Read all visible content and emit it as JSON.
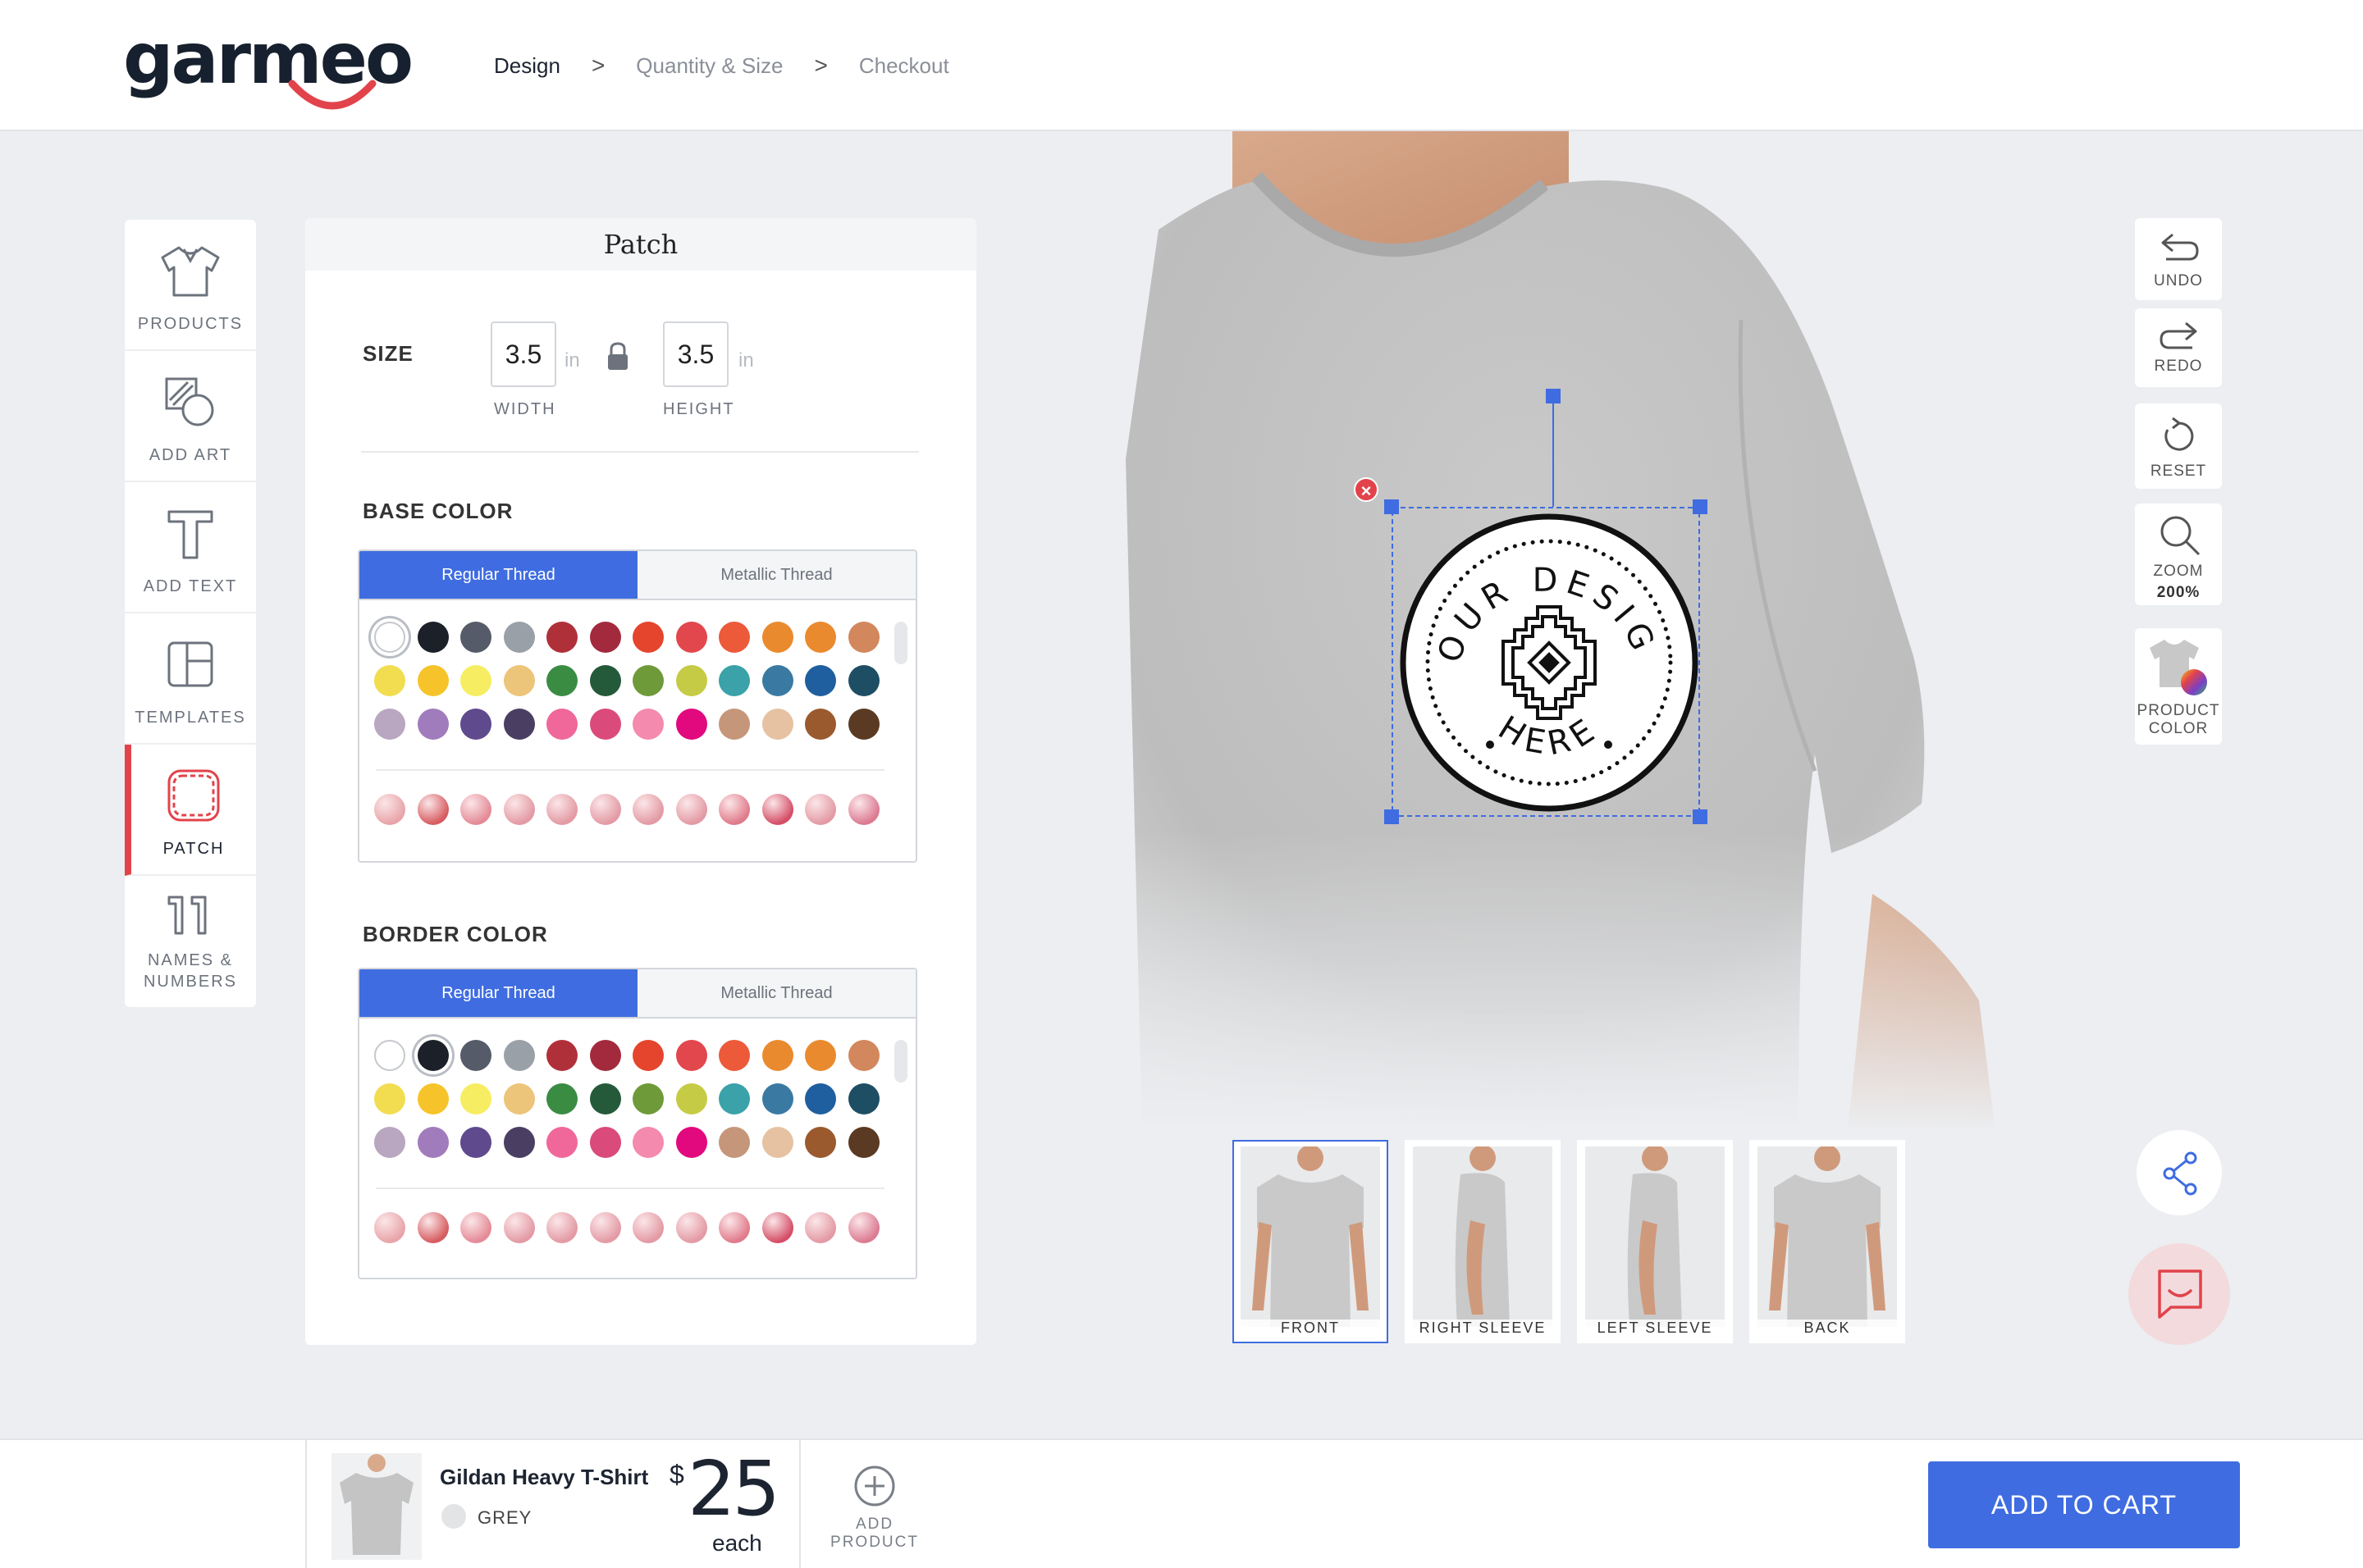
{
  "brand": {
    "logo": "garmeo"
  },
  "breadcrumbs": [
    "Design",
    "Quantity & Size",
    "Checkout"
  ],
  "tools": [
    {
      "label": "PRODUCTS",
      "icon": "shirt-icon"
    },
    {
      "label": "ADD ART",
      "icon": "add-art-icon"
    },
    {
      "label": "ADD TEXT",
      "icon": "text-icon"
    },
    {
      "label": "TEMPLATES",
      "icon": "templates-icon"
    },
    {
      "label": "PATCH",
      "icon": "patch-icon"
    },
    {
      "label_line1": "NAMES &",
      "label_line2": "NUMBERS",
      "icon": "numbers-icon"
    }
  ],
  "panel": {
    "title": "Patch",
    "size_label": "SIZE",
    "width_value": "3.5",
    "height_value": "3.5",
    "unit": "in",
    "width_caption": "WIDTH",
    "height_caption": "HEIGHT",
    "base_color_title": "BASE COLOR",
    "border_color_title": "BORDER COLOR",
    "tab_regular": "Regular Thread",
    "tab_metallic": "Metallic Thread"
  },
  "thread_colors": [
    [
      "#ffffff",
      "#1b2029",
      "#555b68",
      "#9aa0a8",
      "#b0303a",
      "#a32a3d",
      "#e5442d",
      "#e2474d",
      "#ec5a3a",
      "#ea8a2e",
      "#ea8a2e",
      "#d2875c"
    ],
    [
      "#f1dd4f",
      "#f6c42a",
      "#f7ed62",
      "#ecc47a",
      "#3a8c43",
      "#245a3a",
      "#6f9a3a",
      "#c6cb45",
      "#3aa2a8",
      "#3a7aa2",
      "#1f5fa0",
      "#1e4e63"
    ],
    [
      "#b9a6c0",
      "#a17cbc",
      "#5e4a8c",
      "#4a3f62",
      "#f0679a",
      "#da4a7a",
      "#f48aad",
      "#e2087e",
      "#c6967a",
      "#e6c2a2",
      "#9a5a2e",
      "#5a3a22"
    ]
  ],
  "metallic_colors": [
    "#e8a4a8",
    "#d65c60",
    "#e48a96",
    "#e39aa4",
    "#e39aa4",
    "#e39aa4",
    "#e39aa4",
    "#e39aa4",
    "#e07a8a",
    "#d44e66",
    "#e39aa4",
    "#dc7a92"
  ],
  "base_selected_index": 0,
  "border_selected_index": 1,
  "patch_text": {
    "top": "YOUR DESIGN",
    "bottom": "HERE"
  },
  "views": [
    {
      "label": "FRONT",
      "active": true
    },
    {
      "label": "RIGHT SLEEVE",
      "active": false
    },
    {
      "label": "LEFT SLEEVE",
      "active": false
    },
    {
      "label": "BACK",
      "active": false
    }
  ],
  "actions": {
    "undo": "UNDO",
    "redo": "REDO",
    "reset": "RESET",
    "zoom": "ZOOM",
    "zoom_level": "200%",
    "product_line1": "PRODUCT",
    "product_line2": "COLOR"
  },
  "footer": {
    "product_name": "Gildan Heavy T-Shirt",
    "product_color": "GREY",
    "currency": "$",
    "price": "25",
    "price_unit": "each",
    "add_line1": "ADD",
    "add_line2": "PRODUCT",
    "cart": "ADD TO CART"
  },
  "colors": {
    "accent": "#3f6ce0",
    "alert": "#e2434b",
    "shirt": "#c8c8c8"
  }
}
